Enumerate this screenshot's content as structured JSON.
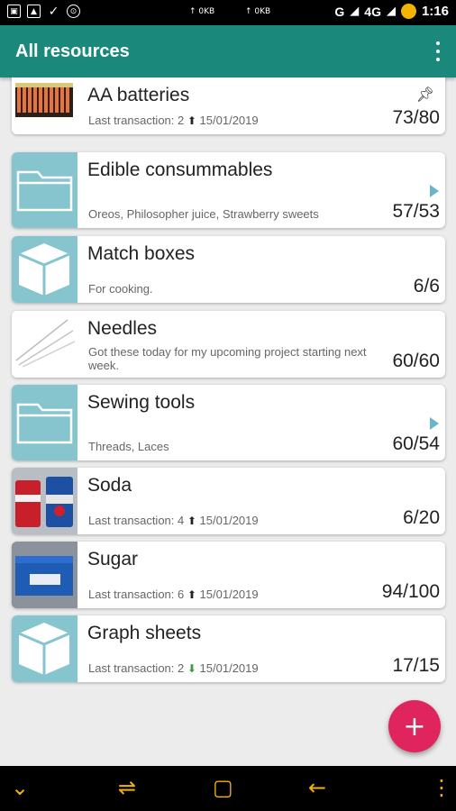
{
  "status_bar": {
    "speed_left": "↑ 0KB",
    "speed_right": "↑ 0KB",
    "network": "G",
    "network2": "4G",
    "time": "1:16"
  },
  "app_bar": {
    "title": "All resources",
    "menu_icon": "overflow-menu-icon"
  },
  "resources": [
    {
      "name": "AA batteries",
      "subtitle_prefix": "Last transaction: 2",
      "subtitle_date": "15/01/2019",
      "trend": "up",
      "count": "73/80",
      "pinned": true,
      "thumb": "photo-batteries"
    },
    {
      "name": "Edible consummables",
      "subtitle": "Oreos, Philosopher juice, Strawberry sweets",
      "count": "57/53",
      "folder": true,
      "thumb": "folder-icon"
    },
    {
      "name": "Match boxes",
      "subtitle": "For cooking.",
      "count": "6/6",
      "thumb": "box-icon"
    },
    {
      "name": "Needles",
      "subtitle": "Got these today for my upcoming project starting next week.",
      "count": "60/60",
      "thumb": "photo-needles"
    },
    {
      "name": "Sewing tools",
      "subtitle": "Threads, Laces",
      "count": "60/54",
      "folder": true,
      "thumb": "folder-icon"
    },
    {
      "name": "Soda",
      "subtitle_prefix": "Last transaction: 4",
      "subtitle_date": "15/01/2019",
      "trend": "up",
      "count": "6/20",
      "thumb": "photo-soda"
    },
    {
      "name": "Sugar",
      "subtitle_prefix": "Last transaction: 6",
      "subtitle_date": "15/01/2019",
      "trend": "up",
      "count": "94/100",
      "thumb": "photo-sugar"
    },
    {
      "name": "Graph sheets",
      "subtitle_prefix": "Last transaction: 2",
      "subtitle_date": "15/01/2019",
      "trend": "down",
      "count": "17/15",
      "thumb": "box-icon"
    }
  ],
  "fab": {
    "label": "+"
  },
  "colors": {
    "app_bar": "#1a897b",
    "thumb_teal": "#86c5cd",
    "fab": "#e0245e",
    "nav_icons": "#f2b400"
  }
}
